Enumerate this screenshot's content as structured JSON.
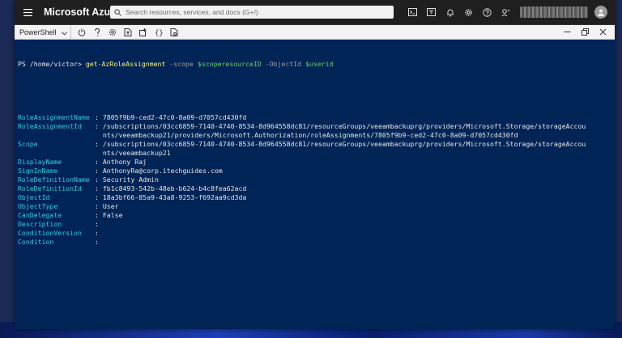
{
  "azure": {
    "brand": "Microsoft Azure",
    "search_placeholder": "Search resources, services, and docs (G+/)"
  },
  "shell": {
    "selector_label": "PowerShell"
  },
  "terminal": {
    "prompt": "PS /home/victor>",
    "command": {
      "cmdlet": "get-AzRoleAssignment",
      "param1": "-scope",
      "var1": "$scoperesourceID",
      "param2": "-ObjectId",
      "var2": "$userid"
    },
    "output": [
      {
        "key": "RoleAssignmentName",
        "lines": [
          "7805f9b9-ced2-47c0-8a09-d7057cd430fd"
        ]
      },
      {
        "key": "RoleAssignmentId",
        "lines": [
          "/subscriptions/03cc6859-7140-4740-8534-8d964558dc81/resourceGroups/veeambackuprg/providers/Microsoft.Storage/storageAccou",
          "nts/veeambackup21/providers/Microsoft.Authorization/roleAssignments/7805f9b9-ced2-47c0-8a09-d7057cd430fd"
        ]
      },
      {
        "key": "Scope",
        "lines": [
          "/subscriptions/03cc6859-7140-4740-8534-8d964558dc81/resourceGroups/veeambackuprg/providers/Microsoft.Storage/storageAccou",
          "nts/veeambackup21"
        ]
      },
      {
        "key": "DisplayName",
        "lines": [
          "Anthony Raj"
        ]
      },
      {
        "key": "SignInName",
        "lines": [
          "AnthonyRa@corp.itechguides.com"
        ]
      },
      {
        "key": "RoleDefinitionName",
        "lines": [
          "Security Admin"
        ]
      },
      {
        "key": "RoleDefinitionId",
        "lines": [
          "fb1c8493-542b-48eb-b624-b4c8fea62acd"
        ]
      },
      {
        "key": "ObjectId",
        "lines": [
          "18a3bf66-85a9-43a8-9253-f692aa9cd3da"
        ]
      },
      {
        "key": "ObjectType",
        "lines": [
          "User"
        ]
      },
      {
        "key": "CanDelegate",
        "lines": [
          "False"
        ]
      },
      {
        "key": "Description",
        "lines": [
          ""
        ]
      },
      {
        "key": "ConditionVersion",
        "lines": [
          ""
        ]
      },
      {
        "key": "Condition",
        "lines": [
          ""
        ]
      }
    ],
    "colors": {
      "background": "#012456",
      "key": "#3ec8e0",
      "cmdlet": "#f5f57a",
      "variable": "#6bd06b",
      "parameter": "#9a9a9a"
    }
  },
  "icons": {
    "topbar": [
      "cloud-shell-icon",
      "directory-filter-icon",
      "bell-icon",
      "gear-icon",
      "help-icon",
      "feedback-icon"
    ],
    "shell_tools": [
      "power-icon",
      "help-icon",
      "gear-icon",
      "upload-download-icon",
      "new-session-icon",
      "braces-icon",
      "web-preview-icon"
    ],
    "window": [
      "minimize-icon",
      "maximize-icon",
      "close-icon"
    ]
  }
}
